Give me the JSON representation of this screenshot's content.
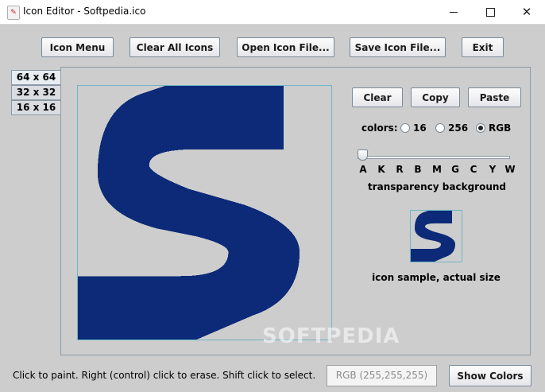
{
  "window": {
    "title": "Icon Editor - Softpedia.ico",
    "app_icon_glyph": "✎",
    "controls": {
      "minimize": "—",
      "maximize": "☐",
      "close": "✕"
    }
  },
  "toolbar": {
    "icon_menu_label": "Icon Menu",
    "clear_all_label": "Clear All Icons",
    "open_label": "Open Icon File...",
    "save_label": "Save Icon File...",
    "exit_label": "Exit"
  },
  "tabs": [
    {
      "label": "64 x 64",
      "active": true
    },
    {
      "label": "32 x 32",
      "active": false
    },
    {
      "label": "16 x 16",
      "active": false
    }
  ],
  "edit_buttons": {
    "clear": "Clear",
    "copy": "Copy",
    "paste": "Paste"
  },
  "colors": {
    "label": "colors:",
    "options": [
      "16",
      "256",
      "RGB"
    ],
    "selected": "RGB"
  },
  "transparency": {
    "ticks": [
      "A",
      "K",
      "R",
      "B",
      "M",
      "G",
      "C",
      "Y",
      "W"
    ],
    "value": "A",
    "label": "transparency background"
  },
  "sample": {
    "label": "icon sample, actual size"
  },
  "status_text": "Click to paint.  Right (control) click to erase.  Shift click to select.",
  "rgb_readout": "RGB (255,255,255)",
  "show_colors_label": "Show Colors",
  "watermark": "SOFTPEDIA",
  "palette": {
    "icon_color": "#0c2a78",
    "background": "#cdcdcd",
    "grid_border": "#6fb7c5"
  }
}
